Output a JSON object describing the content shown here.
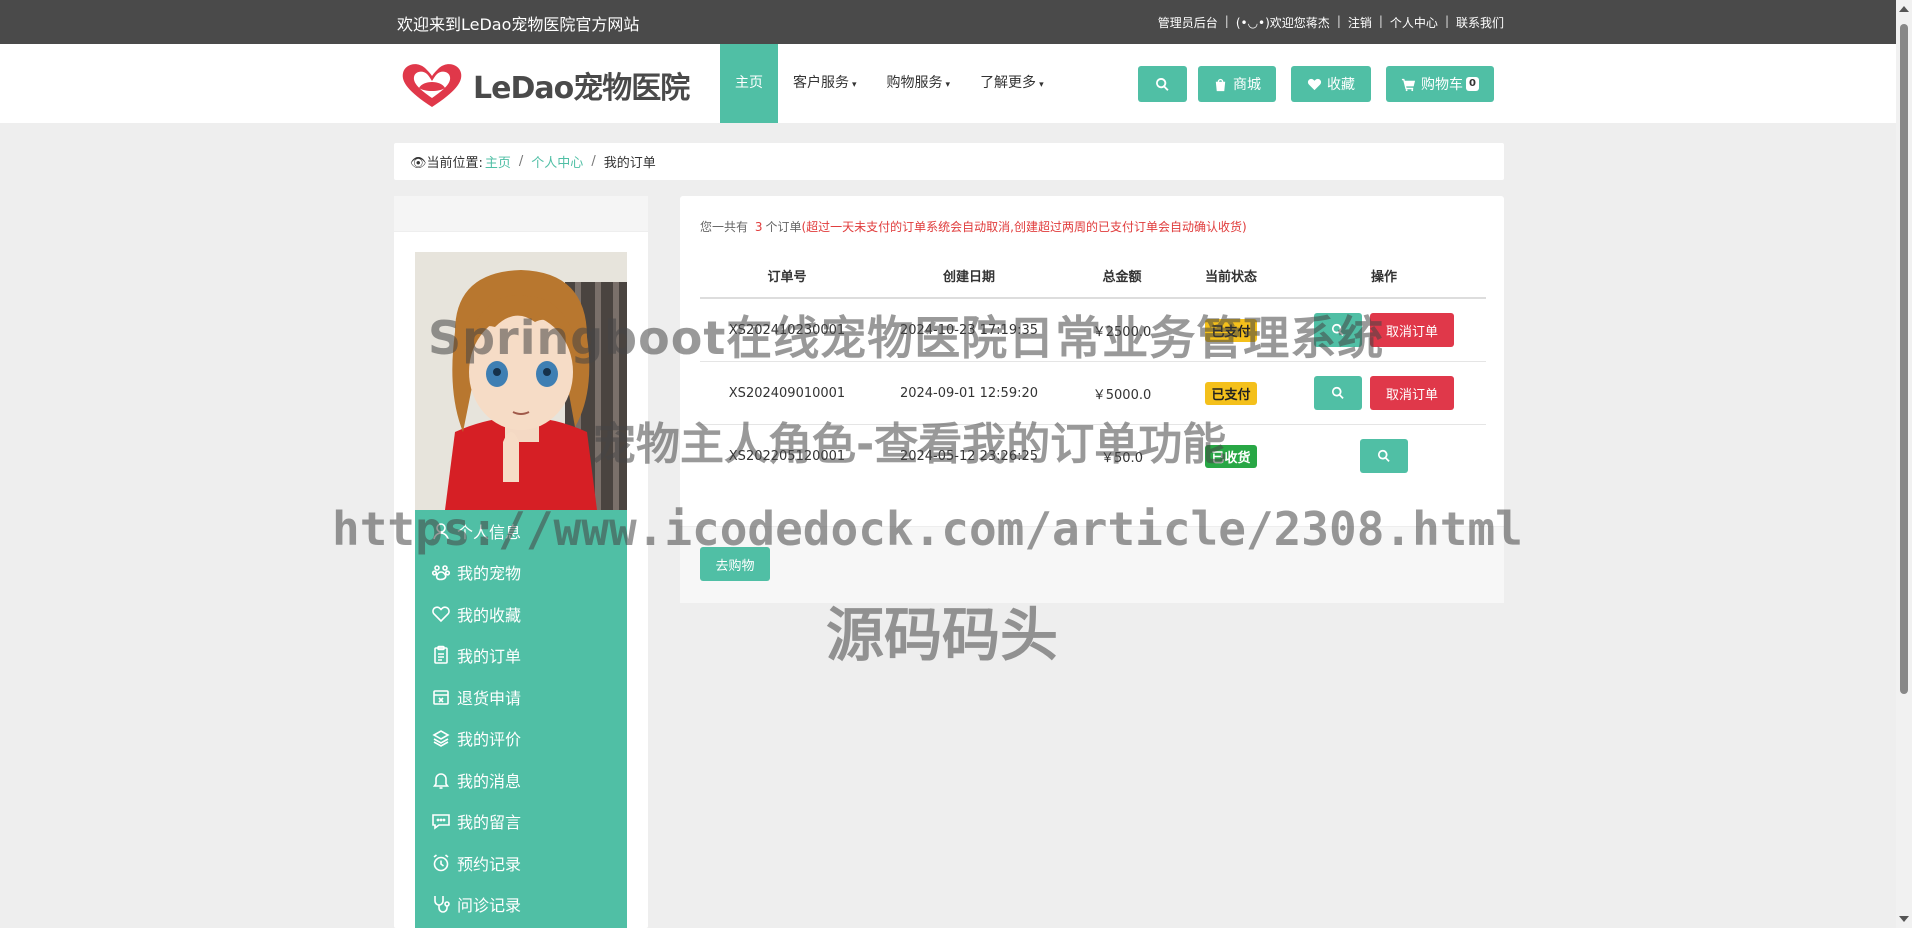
{
  "topbar": {
    "welcome": "欢迎来到LeDao宠物医院官方网站",
    "links": [
      "管理员后台",
      "(•◡•)欢迎您蒋杰",
      "注销",
      "个人中心",
      "联系我们"
    ],
    "separator": "|"
  },
  "header": {
    "logo_text": "LeDao宠物医院",
    "nav": [
      {
        "label": "主页",
        "active": true
      },
      {
        "label": "客户服务",
        "caret": "▾"
      },
      {
        "label": "购物服务",
        "caret": "▾"
      },
      {
        "label": "了解更多",
        "caret": "▾"
      }
    ],
    "buttons": {
      "shop": "商城",
      "favorites": "收藏",
      "cart": "购物车",
      "cart_count": "0"
    }
  },
  "breadcrumb": {
    "prefix": "👁当前位置:",
    "home": "主页",
    "personal": "个人中心",
    "current": "我的订单",
    "sep": "/"
  },
  "sidebar": {
    "items": [
      {
        "label": "个人信息",
        "icon": "user-icon"
      },
      {
        "label": "我的宠物",
        "icon": "paw-icon"
      },
      {
        "label": "我的收藏",
        "icon": "heart-icon"
      },
      {
        "label": "我的订单",
        "icon": "clipboard-icon"
      },
      {
        "label": "退货申请",
        "icon": "return-box-icon"
      },
      {
        "label": "我的评价",
        "icon": "review-icon"
      },
      {
        "label": "我的消息",
        "icon": "bell-icon"
      },
      {
        "label": "我的留言",
        "icon": "comment-icon"
      },
      {
        "label": "预约记录",
        "icon": "alarm-icon"
      },
      {
        "label": "问诊记录",
        "icon": "stethoscope-icon"
      }
    ]
  },
  "orders": {
    "summary_prefix": "您一共有",
    "count": "3",
    "summary_suffix": "个订单",
    "notice": "(超过一天未支付的订单系统会自动取消,创建超过两周的已支付订单会自动确认收货)",
    "headers": [
      "订单号",
      "创建日期",
      "总金额",
      "当前状态",
      "操作"
    ],
    "rows": [
      {
        "no": "XS202410230001",
        "date": "2024-10-23 17:19:35",
        "amount": "￥2500.0",
        "status": "已支付",
        "status_type": "paid",
        "cancel": "取消订单"
      },
      {
        "no": "XS202409010001",
        "date": "2024-09-01 12:59:20",
        "amount": "￥5000.0",
        "status": "已支付",
        "status_type": "paid",
        "cancel": "取消订单"
      },
      {
        "no": "XS202205120001",
        "date": "2024-05-12 23:26:25",
        "amount": "￥50.0",
        "status": "已收货",
        "status_type": "done",
        "cancel": ""
      }
    ],
    "shop_button": "去购物"
  },
  "watermark": {
    "line1": "Springboot在线宠物医院日常业务管理系统",
    "line2": "宠物主人角色-查看我的订单功能",
    "line3": "https://www.icodedock.com/article/2308.html",
    "line4": "源码码头"
  },
  "colors": {
    "accent": "#50bfa5",
    "danger": "#e0384a",
    "warning": "#f4c01b",
    "success": "#28a745",
    "topbar": "#4a4a4a"
  }
}
